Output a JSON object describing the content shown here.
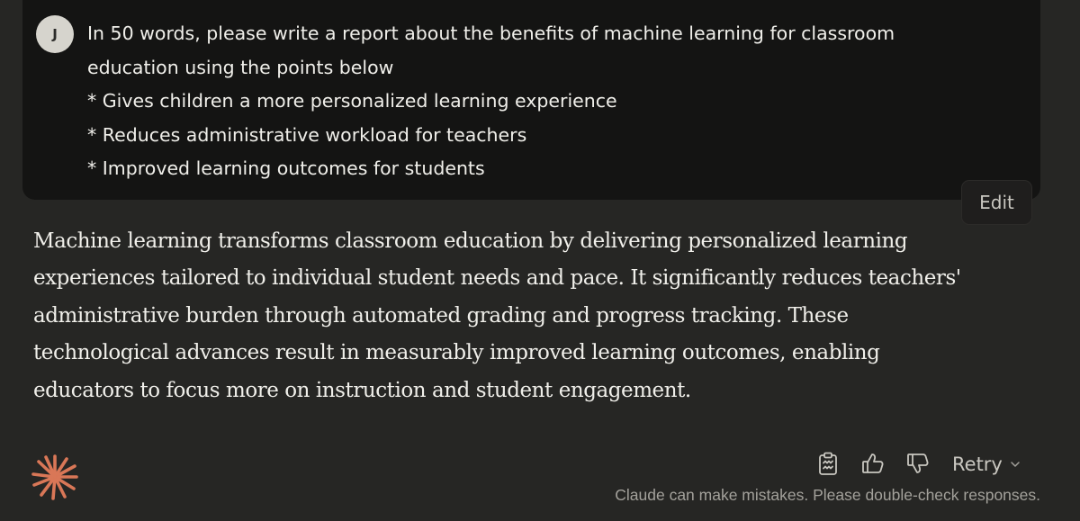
{
  "user_message": {
    "avatar_initial": "J",
    "lines": [
      "In 50 words, please write a report about the benefits of machine learning for classroom",
      "education using the points below",
      "* Gives children a more personalized learning experience",
      "* Reduces administrative workload for teachers",
      "* Improved learning outcomes for students"
    ],
    "edit_label": "Edit"
  },
  "assistant_message": {
    "lines": [
      "Machine learning transforms classroom education by delivering personalized learning",
      "experiences tailored to individual student needs and pace. It significantly reduces teachers'",
      "administrative burden through automated grading and progress tracking. These",
      "technological advances result in measurably improved learning outcomes, enabling",
      "educators to focus more on instruction and student engagement."
    ]
  },
  "actions": {
    "copy_icon": "copy-icon",
    "thumbs_up_icon": "thumbs-up-icon",
    "thumbs_down_icon": "thumbs-down-icon",
    "retry_label": "Retry"
  },
  "disclaimer": "Claude can make mistakes. Please double-check responses.",
  "colors": {
    "background": "#262624",
    "user_bubble": "#141413",
    "accent_logo": "#d97757",
    "text": "#f0efea"
  }
}
